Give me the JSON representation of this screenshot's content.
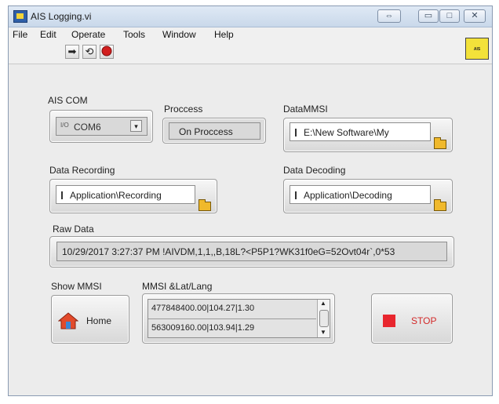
{
  "window": {
    "title": "AIS Logging.vi"
  },
  "menu": [
    "File",
    "Edit",
    "Operate",
    "Tools",
    "Window",
    "Help"
  ],
  "toolbar": {
    "run_icon": "run-arrow-icon",
    "run_continuous_icon": "run-continuous-icon",
    "abort_icon": "abort-stop-icon"
  },
  "controls": {
    "ais_com": {
      "label": "AIS COM",
      "value": "COM6",
      "prefix": "I/O"
    },
    "process": {
      "label": "Proccess",
      "value": "On Proccess"
    },
    "data_mmsi": {
      "label": "DataMMSI",
      "value": "E:\\New Software\\My"
    },
    "data_recording": {
      "label": "Data Recording",
      "value": "Application\\Recording"
    },
    "data_decoding": {
      "label": "Data Decoding",
      "value": "Application\\Decoding"
    },
    "raw_data": {
      "label": "Raw Data",
      "value": "10/29/2017 3:27:37 PM  !AIVDM,1,1,,B,18L?<P5P1?WK31f0eG=52Ovt04r`,0*53"
    },
    "show_mmsi": {
      "label": "Show MMSI",
      "button_label": "Home"
    },
    "mmsi_list": {
      "label": "MMSI &Lat/Lang",
      "items": [
        "477848400.00|104.27|1.30",
        "563009160.00|103.94|1.29"
      ]
    },
    "stop": {
      "label": "STOP"
    }
  },
  "colors": {
    "stop_red": "#e8262e",
    "stop_text": "#d22a2a",
    "folder_yellow": "#f0b92c"
  }
}
